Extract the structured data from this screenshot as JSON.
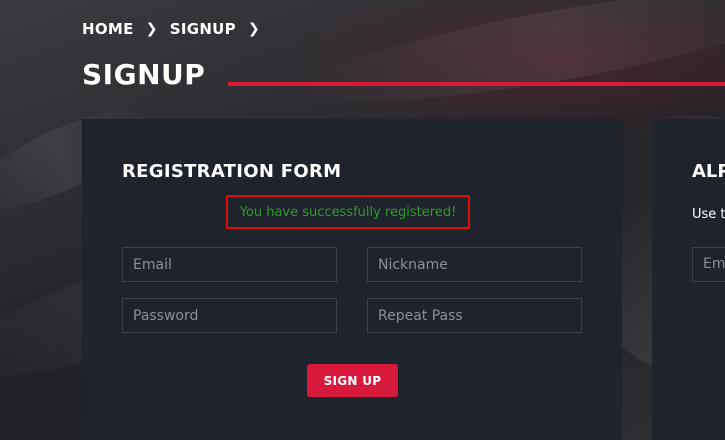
{
  "breadcrumb": {
    "home": "HOME",
    "signup": "SIGNUP"
  },
  "page": {
    "title": "SIGNUP"
  },
  "registration": {
    "title": "REGISTRATION FORM",
    "success_message": "You have successfully registered!",
    "email_placeholder": "Email",
    "nickname_placeholder": "Nickname",
    "password_placeholder": "Password",
    "repeat_placeholder": "Repeat Pass",
    "submit_label": "SIGN UP"
  },
  "right_panel": {
    "title": "ALP",
    "text": "Use t",
    "field_placeholder": "Ema"
  },
  "colors": {
    "accent": "#d71a3c",
    "panel": "#1f232b",
    "success": "#2f9a2f",
    "highlight": "#e00b0b"
  },
  "icons": {
    "breadcrumb_separator": "chevron-right-icon"
  }
}
